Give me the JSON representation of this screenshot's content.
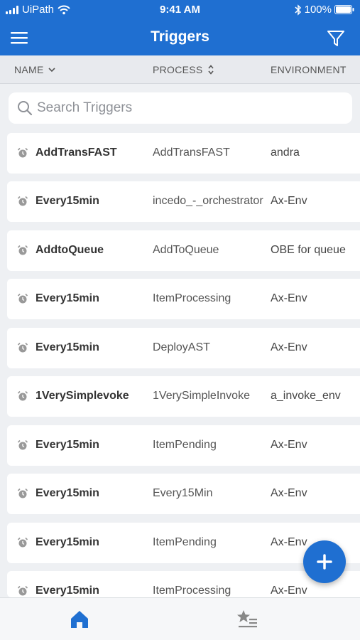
{
  "status_bar": {
    "carrier": "UiPath",
    "time": "9:41 AM",
    "battery": "100%",
    "icons": [
      "signal-icon",
      "wifi-icon",
      "bluetooth-icon",
      "battery-icon"
    ]
  },
  "header": {
    "title": "Triggers",
    "accent_color": "#1f6fd1",
    "icons": [
      "menu-icon",
      "filter-icon"
    ]
  },
  "columns": {
    "name": "NAME",
    "process": "PROCESS",
    "environment": "ENVIRONMENT"
  },
  "search": {
    "placeholder": "Search Triggers"
  },
  "triggers": [
    {
      "name": "AddTransFAST",
      "process": "AddTransFAST",
      "environment": "andra"
    },
    {
      "name": "Every15min",
      "process": "incedo_-_orchestrator",
      "environment": "Ax-Env"
    },
    {
      "name": "AddtoQueue",
      "process": "AddToQueue",
      "environment": "OBE for queue"
    },
    {
      "name": "Every15min",
      "process": "ItemProcessing",
      "environment": "Ax-Env"
    },
    {
      "name": "Every15min",
      "process": "DeployAST",
      "environment": "Ax-Env"
    },
    {
      "name": "1VerySimplevoke",
      "process": "1VerySimpleInvoke",
      "environment": "a_invoke_env"
    },
    {
      "name": "Every15min",
      "process": "ItemPending",
      "environment": "Ax-Env"
    },
    {
      "name": "Every15min",
      "process": "Every15Min",
      "environment": "Ax-Env"
    },
    {
      "name": "Every15min",
      "process": "ItemPending",
      "environment": "Ax-Env"
    },
    {
      "name": "Every15min",
      "process": "ItemProcessing",
      "environment": "Ax-Env"
    }
  ],
  "fab": {
    "icon": "plus-icon"
  },
  "tabbar": {
    "tabs": [
      {
        "icon": "home-icon",
        "active": true
      },
      {
        "icon": "favorites-list-icon",
        "active": false
      }
    ]
  }
}
